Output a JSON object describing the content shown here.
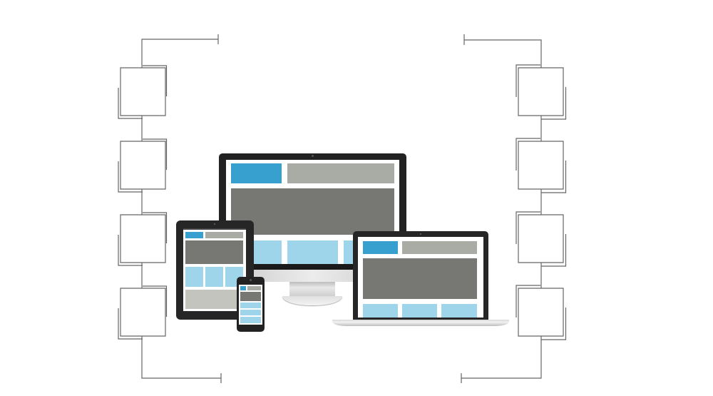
{
  "illustration": {
    "subject": "responsive-web-design",
    "devices": [
      "desktop-monitor",
      "tablet",
      "laptop",
      "smartphone"
    ],
    "left_placeholder_count": 4,
    "right_placeholder_count": 4
  },
  "colors": {
    "line": "#666666",
    "bezel": "#222222",
    "screen_bg": "#ffffff",
    "accent_blue": "#37a0cf",
    "light_gray": "#a9aba5",
    "dark_gray": "#777873",
    "light_blue": "#9fd5ea",
    "pale_gray": "#c4c4bf",
    "silver": "#d8d8d8"
  }
}
